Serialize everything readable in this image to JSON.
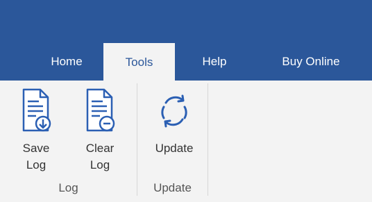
{
  "tabs": [
    {
      "label": "Home",
      "active": false
    },
    {
      "label": "Tools",
      "active": true
    },
    {
      "label": "Help",
      "active": false
    },
    {
      "label": "Buy Online",
      "active": false
    }
  ],
  "groups": [
    {
      "label": "Log",
      "buttons": [
        {
          "label": "Save\nLog",
          "icon": "save-log-icon"
        },
        {
          "label": "Clear\nLog",
          "icon": "clear-log-icon"
        }
      ]
    },
    {
      "label": "Update",
      "buttons": [
        {
          "label": "Update",
          "icon": "refresh-icon"
        }
      ]
    }
  ],
  "colors": {
    "header_bg": "#2b579a",
    "ribbon_bg": "#f3f3f3",
    "icon_blue": "#2b5fb3"
  }
}
